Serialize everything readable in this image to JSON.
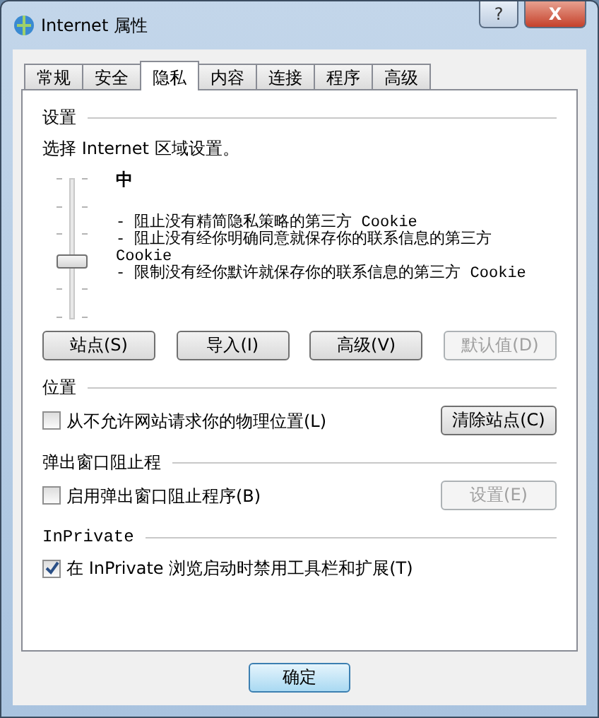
{
  "window": {
    "title": "Internet 属性",
    "buttons": [
      "?",
      "X"
    ]
  },
  "tabs": [
    {
      "label": "常规",
      "selected": false
    },
    {
      "label": "安全",
      "selected": false
    },
    {
      "label": "隐私",
      "selected": true
    },
    {
      "label": "内容",
      "selected": false
    },
    {
      "label": "连接",
      "selected": false
    },
    {
      "label": "程序",
      "selected": false
    },
    {
      "label": "高级",
      "selected": false
    }
  ],
  "settings": {
    "heading": "设置",
    "prompt": "选择 Internet 区域设置。",
    "slider": {
      "level": 0.4
    },
    "level_name": "中",
    "descriptions": [
      "- 阻止没有精简隐私策略的第三方 Cookie",
      "- 阻止没有经你明确同意就保存你的联系信息的第三方 Cookie",
      "- 限制没有经你默许就保存你的联系信息的第三方 Cookie"
    ],
    "buttons": [
      {
        "label": "站点(S)",
        "disabled": false
      },
      {
        "label": "导入(I)",
        "disabled": false
      },
      {
        "label": "高级(V)",
        "disabled": false
      },
      {
        "label": "默认值(D)",
        "disabled": true
      }
    ]
  },
  "sections": [
    {
      "heading": "位置",
      "checkbox": {
        "label": "从不允许网站请求你的物理位置(L)",
        "checked": false
      },
      "button": {
        "label": "清除站点(C)",
        "disabled": false
      }
    },
    {
      "heading": "弹出窗口阻止程",
      "checkbox": {
        "label": "启用弹出窗口阻止程序(B)",
        "checked": false
      },
      "button": {
        "label": "设置(E)",
        "disabled": true
      }
    },
    {
      "heading": "InPrivate",
      "checkbox": {
        "label": "在 InPrivate 浏览启动时禁用工具栏和扩展(T)",
        "checked": true
      }
    }
  ],
  "footer_buttons": [
    "确定"
  ]
}
